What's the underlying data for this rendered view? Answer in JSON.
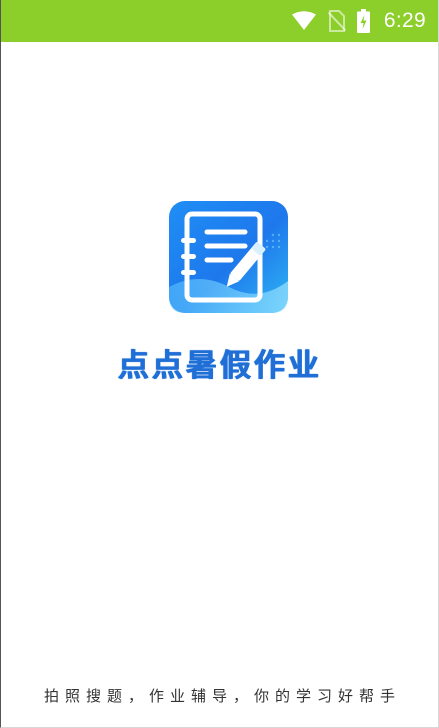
{
  "status_bar": {
    "time": "6:29",
    "background": "#8ccf2a",
    "icons": [
      "wifi-icon",
      "no-sim-icon",
      "battery-charging-icon"
    ]
  },
  "app": {
    "name": "点点暑假作业",
    "icon": "notebook-pen-icon",
    "tagline": "拍照搜题，作业辅导，你的学习好帮手",
    "accent_color": "#1f6fd7"
  }
}
